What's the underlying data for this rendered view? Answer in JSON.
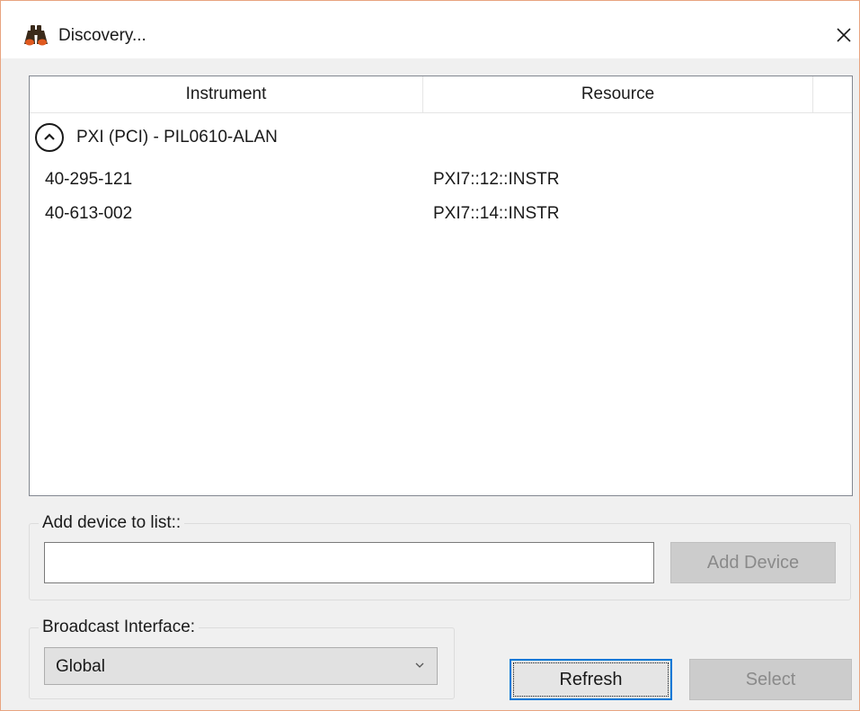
{
  "window": {
    "title": "Discovery...",
    "icon": "binoculars-icon",
    "close_icon": "close-icon"
  },
  "list": {
    "columns": [
      "Instrument",
      "Resource"
    ],
    "group": {
      "label": "PXI (PCI) - PIL0610-ALAN",
      "expanded": true,
      "toggle_icon": "chevron-up-icon"
    },
    "rows": [
      {
        "instrument": "40-295-121",
        "resource": "PXI7::12::INSTR"
      },
      {
        "instrument": "40-613-002",
        "resource": "PXI7::14::INSTR"
      }
    ]
  },
  "add_device": {
    "label": "Add device to list::",
    "input_value": "",
    "button_label": "Add Device",
    "button_enabled": false
  },
  "broadcast": {
    "label": "Broadcast Interface:",
    "selected": "Global",
    "dropdown_icon": "chevron-down-icon"
  },
  "buttons": {
    "refresh": "Refresh",
    "select": "Select",
    "select_enabled": false
  },
  "colors": {
    "window_border": "#e8a480",
    "focus": "#0078d7"
  }
}
